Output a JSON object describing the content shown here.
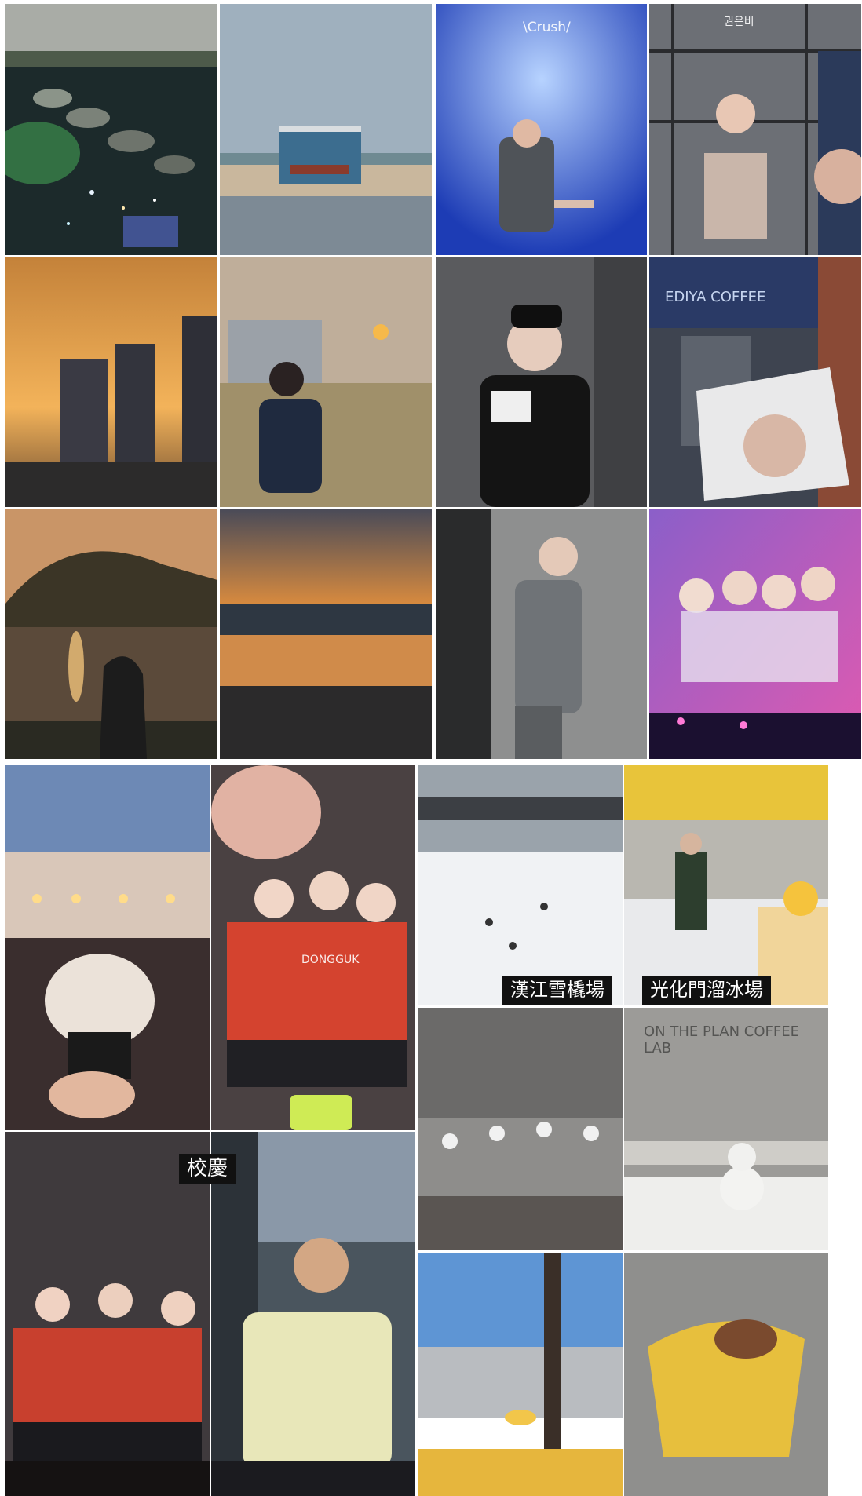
{
  "captions": {
    "top_left_panel": "\\Crush/",
    "top_right_handle": "권은비",
    "hangang_sled": "漢江雪橇場",
    "gwanghwamun_ice": "光化門溜冰場",
    "festival": "校慶"
  },
  "signs": {
    "cafe_sign": "EDIYA COFFEE",
    "jersey": "DONGGUK",
    "coffee_lab": "ON THE PLAN COFFEE LAB"
  }
}
